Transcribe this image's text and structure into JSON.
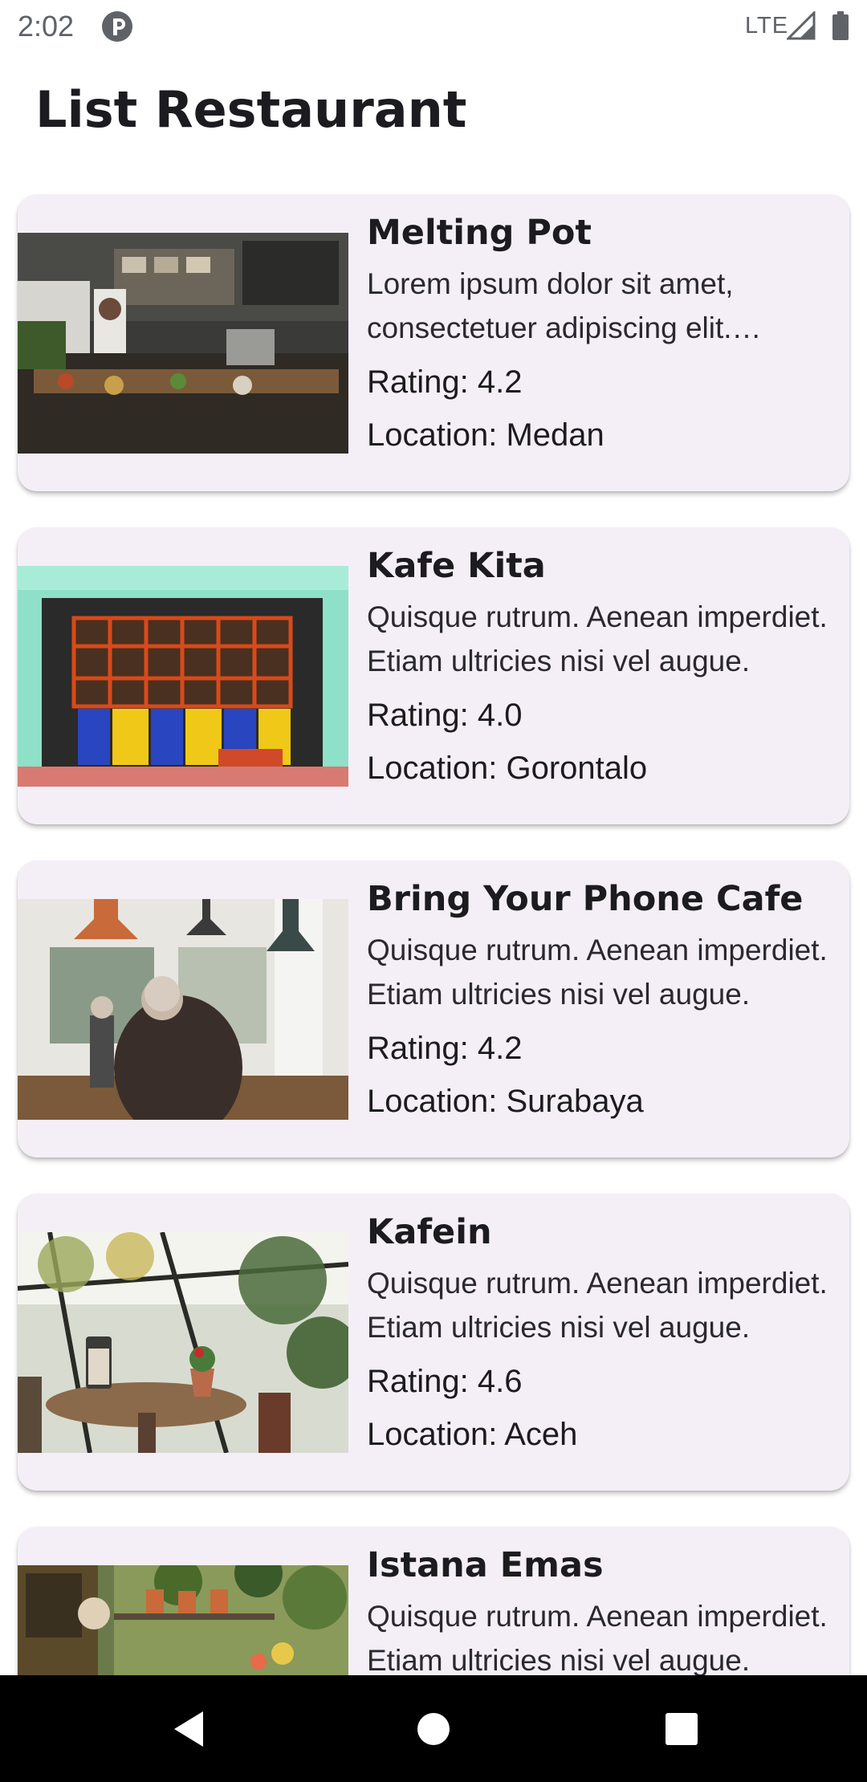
{
  "status_bar": {
    "time": "2:02",
    "network": "LTE",
    "app_icon": "pocket-app-icon",
    "signal_icon": "signal-icon",
    "battery_icon": "battery-icon"
  },
  "app_bar": {
    "title": "List Restaurant"
  },
  "restaurants": [
    {
      "name": "Melting Pot",
      "description": "Lorem ipsum dolor sit amet, consectetuer adipiscing elit. Aenean commodo ligula eget dolor.",
      "rating": "Rating: 4.2",
      "location": "Location: Medan",
      "image": "kitchen-counter-photo"
    },
    {
      "name": "Kafe Kita",
      "description": "Quisque rutrum. Aenean imperdiet. Etiam ultricies nisi vel augue.",
      "rating": "Rating: 4.0",
      "location": "Location: Gorontalo",
      "image": "colorful-storefront-photo"
    },
    {
      "name": "Bring Your Phone Cafe",
      "description": "Quisque rutrum. Aenean imperdiet. Etiam ultricies nisi vel augue.",
      "rating": "Rating: 4.2",
      "location": "Location: Surabaya",
      "image": "cafe-interior-photo"
    },
    {
      "name": "Kafein",
      "description": "Quisque rutrum. Aenean imperdiet. Etiam ultricies nisi vel augue.",
      "rating": "Rating: 4.6",
      "location": "Location: Aceh",
      "image": "greenhouse-table-photo"
    },
    {
      "name": "Istana Emas",
      "description": "Quisque rutrum. Aenean imperdiet. Etiam ultricies nisi vel augue.",
      "rating": "",
      "location": "",
      "image": "garden-cafe-photo"
    }
  ],
  "nav_bar": {
    "back_icon": "back-triangle-icon",
    "home_icon": "home-circle-icon",
    "recents_icon": "recents-square-icon"
  },
  "colors": {
    "card_background": "#f4eff7",
    "title_text": "#1c1b1f",
    "nav_bar": "#000000",
    "status_text": "#5f6368"
  }
}
